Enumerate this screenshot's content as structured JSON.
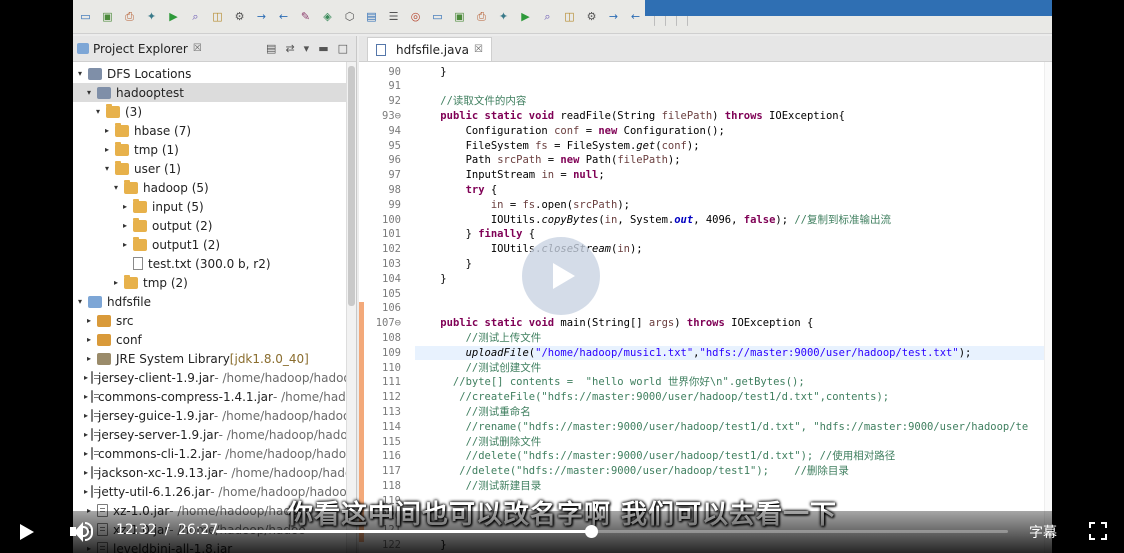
{
  "window": {
    "toolbar_icons": [
      "new-icon",
      "save-icon",
      "print-icon",
      "debug-icon",
      "run-icon",
      "search-icon",
      "open-type-icon",
      "build-icon",
      "settings-icon",
      "next-icon",
      "back-icon"
    ]
  },
  "explorer": {
    "title": "Project Explorer",
    "tab_close": "☒",
    "tree": [
      {
        "label": "DFS Locations",
        "suffix": "",
        "indent": 0,
        "twisty": "▾",
        "icon": "db",
        "selected": false
      },
      {
        "label": "hadooptest",
        "suffix": "",
        "indent": 1,
        "twisty": "▾",
        "icon": "db",
        "selected": true
      },
      {
        "label": "(3)",
        "suffix": "",
        "indent": 2,
        "twisty": "▾",
        "icon": "folder",
        "selected": false
      },
      {
        "label": "hbase (7)",
        "suffix": "",
        "indent": 3,
        "twisty": "▸",
        "icon": "folder",
        "selected": false
      },
      {
        "label": "tmp (1)",
        "suffix": "",
        "indent": 3,
        "twisty": "▸",
        "icon": "folder",
        "selected": false
      },
      {
        "label": "user (1)",
        "suffix": "",
        "indent": 3,
        "twisty": "▾",
        "icon": "folder",
        "selected": false
      },
      {
        "label": "hadoop (5)",
        "suffix": "",
        "indent": 4,
        "twisty": "▾",
        "icon": "folder",
        "selected": false
      },
      {
        "label": "input (5)",
        "suffix": "",
        "indent": 5,
        "twisty": "▸",
        "icon": "folder",
        "selected": false
      },
      {
        "label": "output (2)",
        "suffix": "",
        "indent": 5,
        "twisty": "▸",
        "icon": "folder",
        "selected": false
      },
      {
        "label": "output1 (2)",
        "suffix": "",
        "indent": 5,
        "twisty": "▸",
        "icon": "folder",
        "selected": false
      },
      {
        "label": "test.txt (300.0 b, r2)",
        "suffix": "",
        "indent": 5,
        "twisty": "",
        "icon": "file",
        "selected": false
      },
      {
        "label": "tmp (2)",
        "suffix": "",
        "indent": 4,
        "twisty": "▸",
        "icon": "folder",
        "selected": false
      },
      {
        "label": "hdfsfile",
        "suffix": "",
        "indent": 0,
        "twisty": "▾",
        "icon": "proj",
        "selected": false
      },
      {
        "label": "src",
        "suffix": "",
        "indent": 1,
        "twisty": "▸",
        "icon": "pkgfolder",
        "selected": false
      },
      {
        "label": "conf",
        "suffix": "",
        "indent": 1,
        "twisty": "▸",
        "icon": "pkgfolder",
        "selected": false
      },
      {
        "label": "JRE System Library ",
        "suffix": "[jdk1.8.0_40]",
        "indent": 1,
        "twisty": "▸",
        "icon": "lib",
        "selected": false
      },
      {
        "label": "jersey-client-1.9.jar",
        "suffix": " - /home/hadoop/hadoop-",
        "indent": 1,
        "twisty": "▸",
        "icon": "jar",
        "selected": false
      },
      {
        "label": "commons-compress-1.4.1.jar",
        "suffix": " - /home/hadoo|",
        "indent": 1,
        "twisty": "▸",
        "icon": "jar",
        "selected": false
      },
      {
        "label": "jersey-guice-1.9.jar",
        "suffix": " - /home/hadoop/hadoop-",
        "indent": 1,
        "twisty": "▸",
        "icon": "jar",
        "selected": false
      },
      {
        "label": "jersey-server-1.9.jar",
        "suffix": " - /home/hadoop/hadoop",
        "indent": 1,
        "twisty": "▸",
        "icon": "jar",
        "selected": false
      },
      {
        "label": "commons-cli-1.2.jar",
        "suffix": " - /home/hadoop/hadoop",
        "indent": 1,
        "twisty": "▸",
        "icon": "jar",
        "selected": false
      },
      {
        "label": "jackson-xc-1.9.13.jar",
        "suffix": " - /home/hadoop/hadoo|",
        "indent": 1,
        "twisty": "▸",
        "icon": "jar",
        "selected": false
      },
      {
        "label": "jetty-util-6.1.26.jar",
        "suffix": " - /home/hadoop/hadoop-",
        "indent": 1,
        "twisty": "▸",
        "icon": "jar",
        "selected": false
      },
      {
        "label": "xz-1.0.jar",
        "suffix": " - /home/hadoop/hadoo",
        "indent": 1,
        "twisty": "▸",
        "icon": "jar",
        "selected": false
      },
      {
        "label": "xz-1.0.jar",
        "suffix": " - /home/hadoop/hadoo",
        "indent": 1,
        "twisty": "▸",
        "icon": "jar",
        "selected": false
      },
      {
        "label": "leveldbjni-all-1.8.jar",
        "suffix": "",
        "indent": 1,
        "twisty": "▸",
        "icon": "jar",
        "selected": false
      }
    ]
  },
  "editor": {
    "tab_label": "hdfsfile.java",
    "tab_close": "☒",
    "highlight_line": 109,
    "lines": [
      {
        "n": "90",
        "segs": [
          {
            "t": "    }",
            "c": ""
          }
        ]
      },
      {
        "n": "91",
        "segs": [
          {
            "t": "",
            "c": ""
          }
        ]
      },
      {
        "n": "92",
        "segs": [
          {
            "t": "    //读取文件的内容",
            "c": "cm"
          }
        ]
      },
      {
        "n": "93⊖",
        "segs": [
          {
            "t": "    ",
            "c": ""
          },
          {
            "t": "public static void",
            "c": "kw"
          },
          {
            "t": " readFile(String ",
            "c": ""
          },
          {
            "t": "filePath",
            "c": "var"
          },
          {
            "t": ") ",
            "c": ""
          },
          {
            "t": "throws",
            "c": "kw"
          },
          {
            "t": " IOException{",
            "c": ""
          }
        ]
      },
      {
        "n": "94",
        "segs": [
          {
            "t": "        Configuration ",
            "c": ""
          },
          {
            "t": "conf",
            "c": "var"
          },
          {
            "t": " = ",
            "c": ""
          },
          {
            "t": "new",
            "c": "kw"
          },
          {
            "t": " Configuration();",
            "c": ""
          }
        ]
      },
      {
        "n": "95",
        "segs": [
          {
            "t": "        FileSystem ",
            "c": ""
          },
          {
            "t": "fs",
            "c": "var"
          },
          {
            "t": " = FileSystem.",
            "c": ""
          },
          {
            "t": "get",
            "c": "it"
          },
          {
            "t": "(",
            "c": ""
          },
          {
            "t": "conf",
            "c": "var"
          },
          {
            "t": ");",
            "c": ""
          }
        ]
      },
      {
        "n": "96",
        "segs": [
          {
            "t": "        Path ",
            "c": ""
          },
          {
            "t": "srcPath",
            "c": "var"
          },
          {
            "t": " = ",
            "c": ""
          },
          {
            "t": "new",
            "c": "kw"
          },
          {
            "t": " Path(",
            "c": ""
          },
          {
            "t": "filePath",
            "c": "var"
          },
          {
            "t": ");",
            "c": ""
          }
        ]
      },
      {
        "n": "97",
        "segs": [
          {
            "t": "        InputStream ",
            "c": ""
          },
          {
            "t": "in",
            "c": "var"
          },
          {
            "t": " = ",
            "c": ""
          },
          {
            "t": "null",
            "c": "kw"
          },
          {
            "t": ";",
            "c": ""
          }
        ]
      },
      {
        "n": "98",
        "segs": [
          {
            "t": "        ",
            "c": ""
          },
          {
            "t": "try",
            "c": "kw"
          },
          {
            "t": " {",
            "c": ""
          }
        ]
      },
      {
        "n": "99",
        "segs": [
          {
            "t": "            ",
            "c": ""
          },
          {
            "t": "in",
            "c": "var"
          },
          {
            "t": " = ",
            "c": ""
          },
          {
            "t": "fs",
            "c": "var"
          },
          {
            "t": ".open(",
            "c": ""
          },
          {
            "t": "srcPath",
            "c": "var"
          },
          {
            "t": ");",
            "c": ""
          }
        ]
      },
      {
        "n": "100",
        "segs": [
          {
            "t": "            IOUtils.",
            "c": ""
          },
          {
            "t": "copyBytes",
            "c": "it"
          },
          {
            "t": "(",
            "c": ""
          },
          {
            "t": "in",
            "c": "var"
          },
          {
            "t": ", System.",
            "c": ""
          },
          {
            "t": "out",
            "c": "fld"
          },
          {
            "t": ", 4096, ",
            "c": ""
          },
          {
            "t": "false",
            "c": "kw"
          },
          {
            "t": "); ",
            "c": ""
          },
          {
            "t": "//复制到标准输出流",
            "c": "cm"
          }
        ]
      },
      {
        "n": "101",
        "segs": [
          {
            "t": "        } ",
            "c": ""
          },
          {
            "t": "finally",
            "c": "kw"
          },
          {
            "t": " {",
            "c": ""
          }
        ]
      },
      {
        "n": "102",
        "segs": [
          {
            "t": "            IOUtils.",
            "c": ""
          },
          {
            "t": "closeStream",
            "c": "it"
          },
          {
            "t": "(",
            "c": ""
          },
          {
            "t": "in",
            "c": "var"
          },
          {
            "t": ");",
            "c": ""
          }
        ]
      },
      {
        "n": "103",
        "segs": [
          {
            "t": "        }",
            "c": ""
          }
        ]
      },
      {
        "n": "104",
        "segs": [
          {
            "t": "    }",
            "c": ""
          }
        ]
      },
      {
        "n": "105",
        "segs": [
          {
            "t": "",
            "c": ""
          }
        ]
      },
      {
        "n": "106",
        "segs": [
          {
            "t": "",
            "c": ""
          }
        ]
      },
      {
        "n": "107⊖",
        "segs": [
          {
            "t": "    ",
            "c": ""
          },
          {
            "t": "public static void",
            "c": "kw"
          },
          {
            "t": " main(String[] ",
            "c": ""
          },
          {
            "t": "args",
            "c": "var"
          },
          {
            "t": ") ",
            "c": ""
          },
          {
            "t": "throws",
            "c": "kw"
          },
          {
            "t": " IOException {",
            "c": ""
          }
        ]
      },
      {
        "n": "108",
        "segs": [
          {
            "t": "        //测试上传文件",
            "c": "cm"
          }
        ]
      },
      {
        "n": "109",
        "segs": [
          {
            "t": "        ",
            "c": ""
          },
          {
            "t": "uploadFile",
            "c": "it"
          },
          {
            "t": "(",
            "c": ""
          },
          {
            "t": "\"/home/hadoop/music1.txt\"",
            "c": "st"
          },
          {
            "t": ",",
            "c": ""
          },
          {
            "t": "\"hdfs://master:9000/user/hadoop/test.txt\"",
            "c": "st"
          },
          {
            "t": ");",
            "c": ""
          }
        ]
      },
      {
        "n": "110",
        "segs": [
          {
            "t": "        //测试创建文件",
            "c": "cm"
          }
        ]
      },
      {
        "n": "111",
        "segs": [
          {
            "t": "      //byte[] contents =  \"hello world 世界你好\\n\".getBytes();",
            "c": "cm"
          }
        ]
      },
      {
        "n": "112",
        "segs": [
          {
            "t": "       //createFile(\"hdfs://master:9000/user/hadoop/test1/d.txt\",contents);",
            "c": "cm"
          }
        ]
      },
      {
        "n": "113",
        "segs": [
          {
            "t": "        //测试重命名",
            "c": "cm"
          }
        ]
      },
      {
        "n": "114",
        "segs": [
          {
            "t": "        //rename(\"hdfs://master:9000/user/hadoop/test1/d.txt\", \"hdfs://master:9000/user/hadoop/te",
            "c": "cm"
          }
        ]
      },
      {
        "n": "115",
        "segs": [
          {
            "t": "        //测试删除文件",
            "c": "cm"
          }
        ]
      },
      {
        "n": "116",
        "segs": [
          {
            "t": "        //delete(\"hdfs://master:9000/user/hadoop/test1/d.txt\"); //使用相对路径",
            "c": "cm"
          }
        ]
      },
      {
        "n": "117",
        "segs": [
          {
            "t": "       //delete(\"hdfs://master:9000/user/hadoop/test1\");    //删除目录",
            "c": "cm"
          }
        ]
      },
      {
        "n": "118",
        "segs": [
          {
            "t": "        //测试新建目录",
            "c": "cm"
          }
        ]
      },
      {
        "n": "119",
        "segs": [
          {
            "t": "",
            "c": ""
          }
        ]
      },
      {
        "n": "120",
        "segs": [
          {
            "t": "",
            "c": ""
          }
        ]
      },
      {
        "n": "121",
        "segs": [
          {
            "t": "",
            "c": ""
          }
        ]
      },
      {
        "n": "122",
        "segs": [
          {
            "t": "    }",
            "c": ""
          }
        ]
      }
    ]
  },
  "player": {
    "subtitle": "你看这中间也可以改名字啊  我们可以去看一下",
    "current_time": "12:32",
    "separator": "/",
    "duration": "26:27",
    "progress": 0.4738,
    "subtitles_button": "字幕"
  }
}
